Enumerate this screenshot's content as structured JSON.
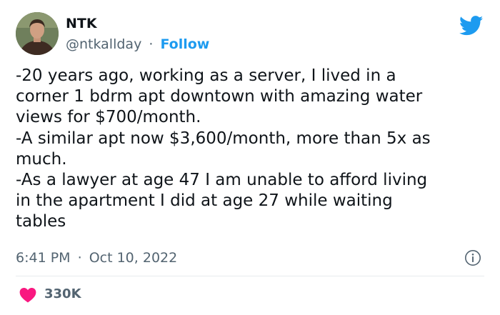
{
  "author": {
    "name": "NTK",
    "handle": "@ntkallday",
    "separator": "·",
    "follow_label": "Follow",
    "avatar_icon": "profile-photo",
    "platform_icon": "twitter-bird-icon"
  },
  "tweet": {
    "text": "-20 years ago, working as a server, I lived in a\ncorner 1 bdrm apt downtown with amazing water\nviews for $700/month.\n-A similar apt now $3,600/month, more than 5x as\nmuch.\n-As a lawyer at age 47 I am unable to afford living\nin the apartment I did at age 27 while waiting\ntables",
    "time": "6:41 PM",
    "separator": "·",
    "date": "Oct 10, 2022"
  },
  "engagement": {
    "likes": "330K",
    "like_icon": "heart-icon",
    "info_icon": "info-icon"
  },
  "colors": {
    "accent": "#1d9bf0",
    "heart": "#f91880",
    "text": "#0f1419",
    "muted": "#536471"
  }
}
